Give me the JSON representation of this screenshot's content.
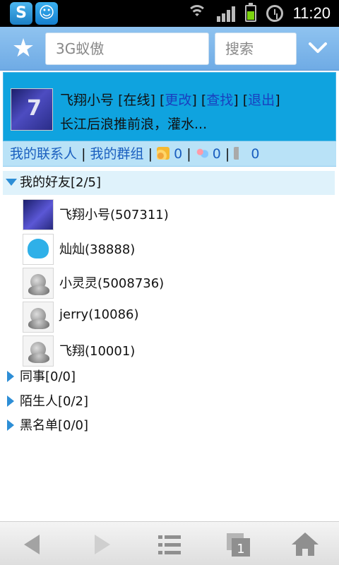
{
  "status_bar": {
    "time": "11:20",
    "icons": [
      "app-s-icon",
      "app-qq-icon",
      "wifi-icon",
      "signal-icon",
      "battery-icon",
      "alarm-icon"
    ]
  },
  "top_bar": {
    "search_value": "3G蚁傲",
    "search_button": "搜索",
    "icons": [
      "star-icon",
      "chevron-down-icon"
    ]
  },
  "profile": {
    "name": "飞翔小号",
    "status": "[在线]",
    "actions": [
      "[",
      "更改",
      "]",
      "[",
      "查找",
      "]",
      "[",
      "退出",
      "]"
    ],
    "link_edit": "更改",
    "link_find": "查找",
    "link_logout": "退出",
    "signature": "长江后浪推前浪，灌水..."
  },
  "tabs": {
    "contacts": "我的联系人",
    "groups": "我的群组",
    "sep": "|",
    "rss_count": "0",
    "group_msg_count": "0",
    "sound_count": "0"
  },
  "groups": [
    {
      "label": "我的好友[2/5]",
      "expanded": true,
      "friends": [
        {
          "name": "飞翔小号(507311)",
          "avatar": "photo"
        },
        {
          "name": "灿灿(38888)",
          "avatar": "heart"
        },
        {
          "name": "小灵灵(5008736)",
          "avatar": "qq"
        },
        {
          "name": "jerry(10086)",
          "avatar": "qq"
        },
        {
          "name": "飞翔(10001)",
          "avatar": "qq"
        }
      ]
    },
    {
      "label": "同事[0/0]",
      "expanded": false
    },
    {
      "label": "陌生人[0/2]",
      "expanded": false
    },
    {
      "label": "黑名单[0/0]",
      "expanded": false
    }
  ],
  "bottom_nav": {
    "tab_count": "1",
    "icons": [
      "back-icon",
      "forward-icon",
      "menu-icon",
      "tabs-icon",
      "home-icon"
    ]
  }
}
